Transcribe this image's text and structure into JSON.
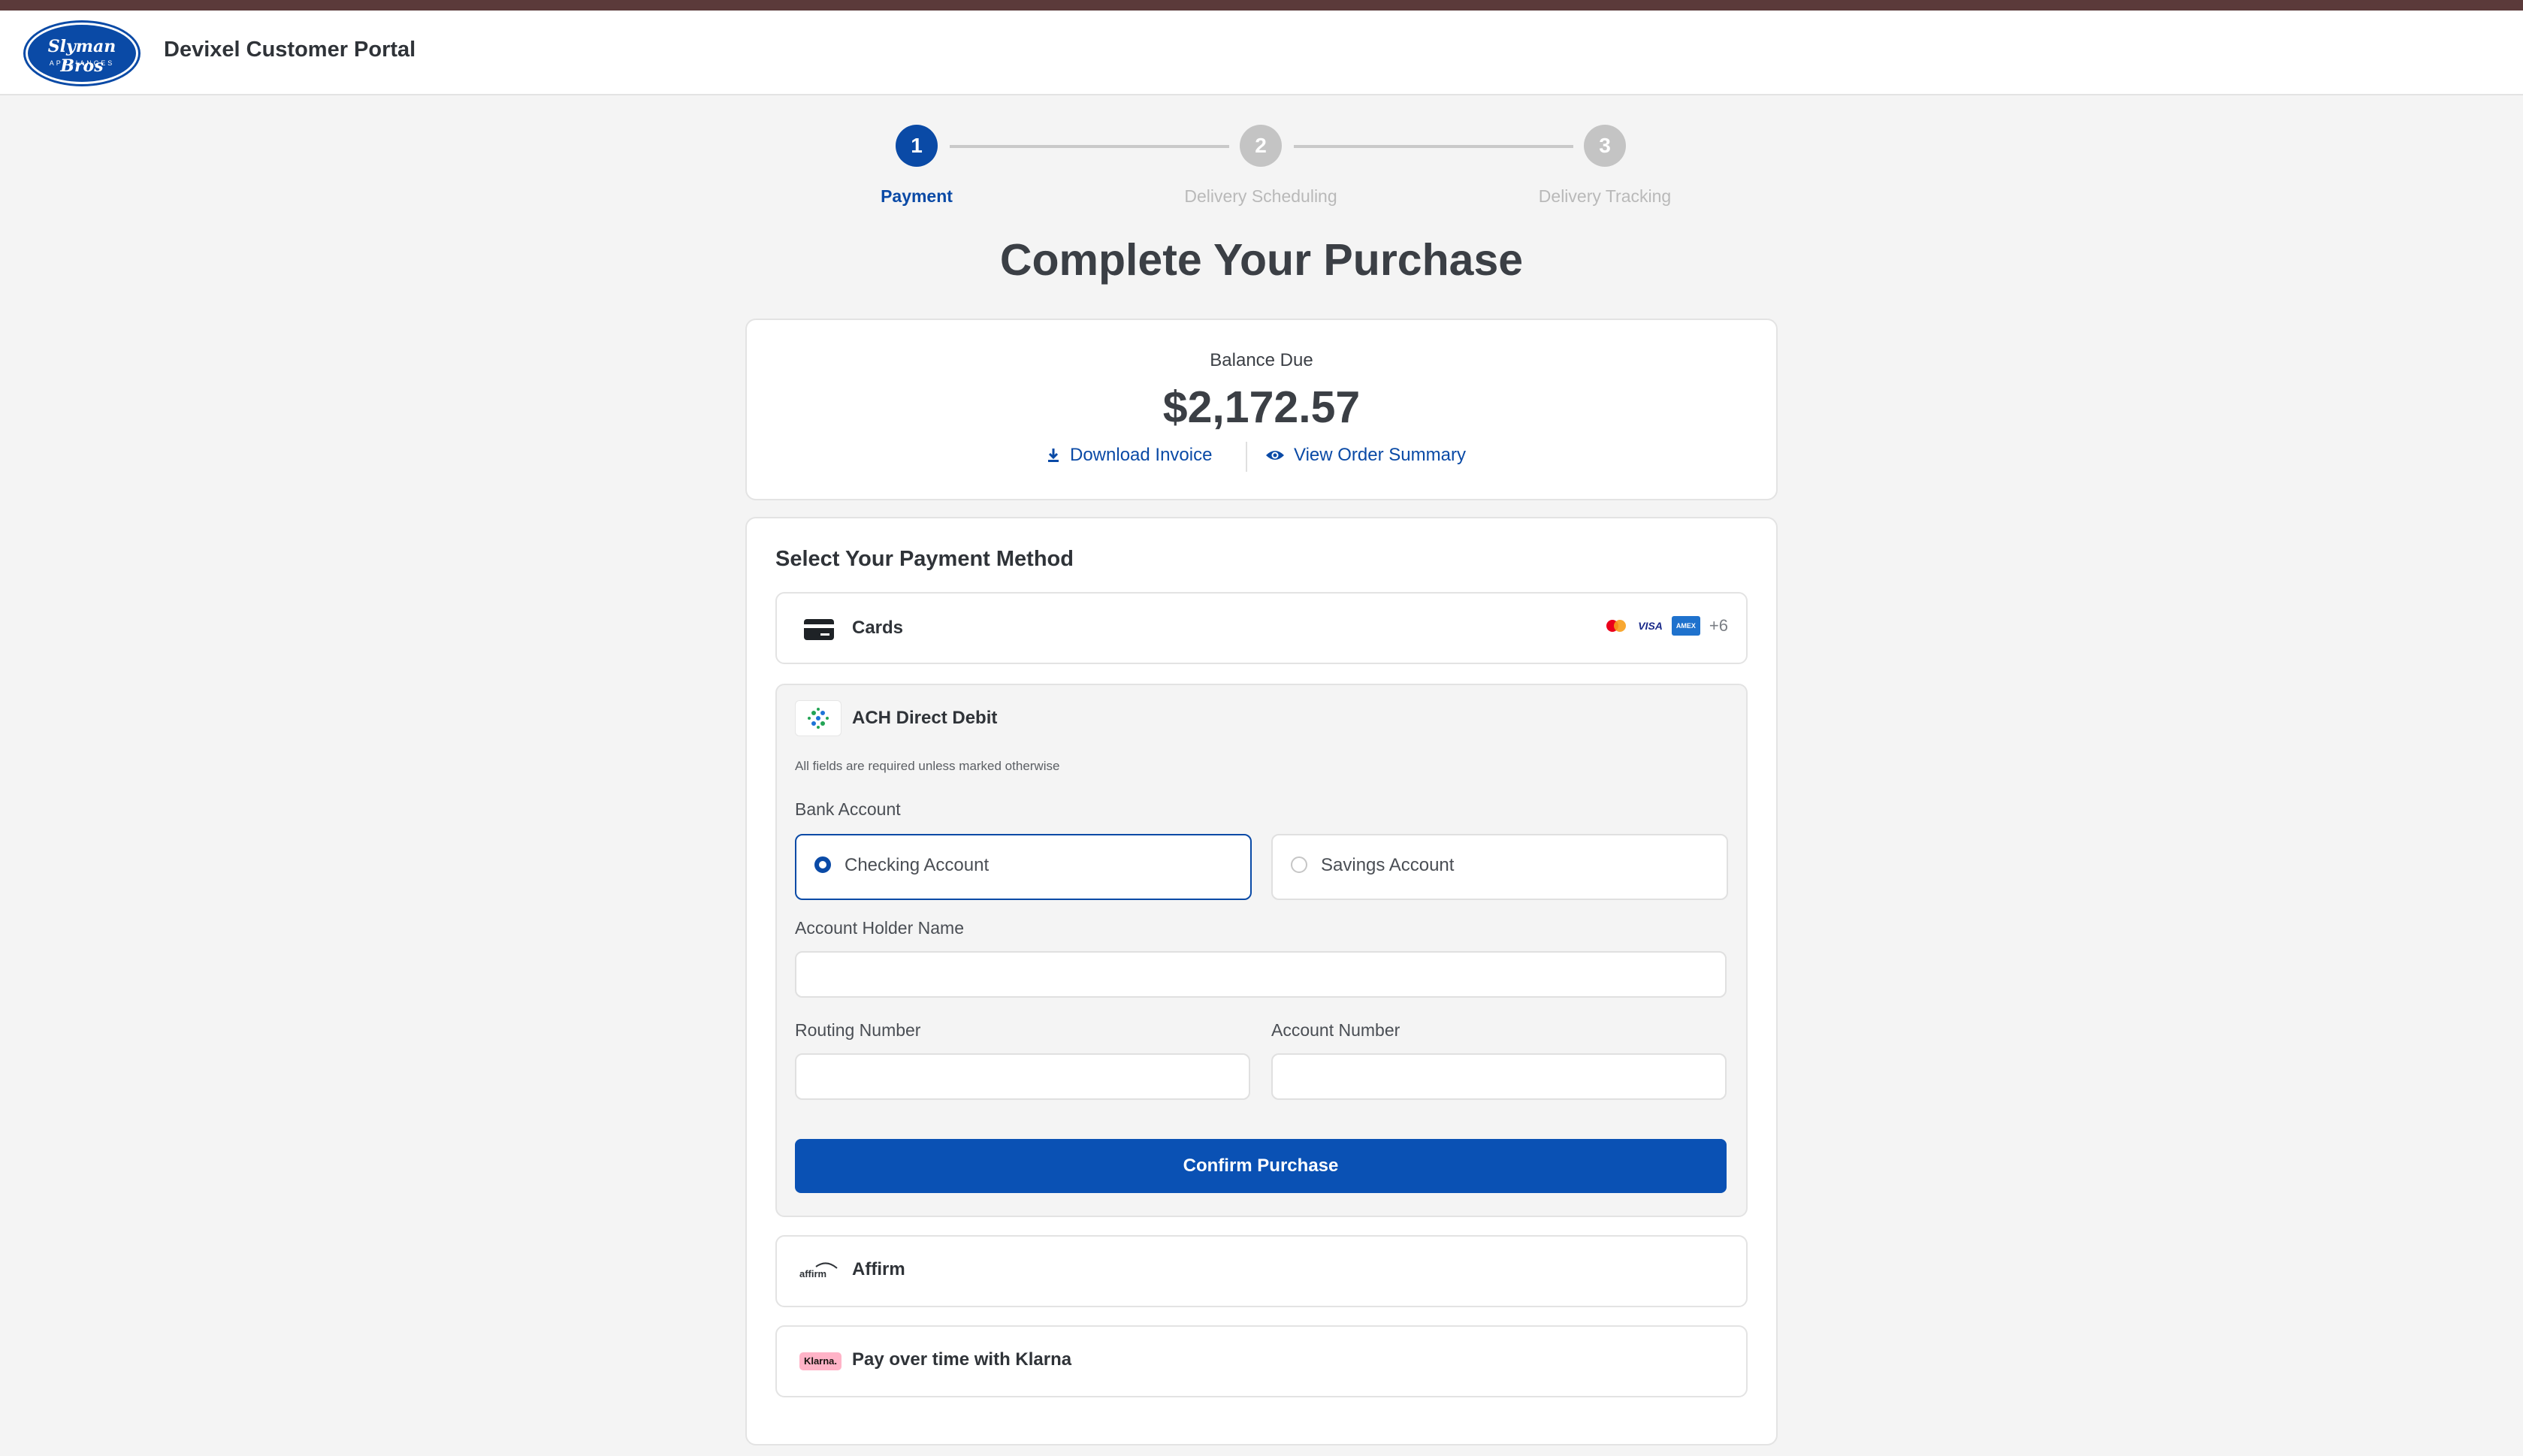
{
  "header": {
    "logo_script": "Slyman Bros",
    "logo_sub": "APPLIANCES",
    "portal_title": "Devixel Customer Portal"
  },
  "stepper": {
    "steps": [
      {
        "number": "1",
        "label": "Payment",
        "state": "active"
      },
      {
        "number": "2",
        "label": "Delivery Scheduling",
        "state": "upcoming"
      },
      {
        "number": "3",
        "label": "Delivery Tracking",
        "state": "upcoming"
      }
    ]
  },
  "page_title": "Complete Your Purchase",
  "balance": {
    "label": "Balance Due",
    "amount": "$2,172.57",
    "download_invoice": "Download Invoice",
    "view_order_summary": "View Order Summary"
  },
  "payment": {
    "heading": "Select Your Payment Method",
    "cards": {
      "label": "Cards",
      "brands": [
        "mastercard",
        "visa",
        "amex"
      ],
      "visa_text": "VISA",
      "amex_text": "AMEX",
      "more": "+6"
    },
    "ach": {
      "label": "ACH Direct Debit",
      "note": "All fields are required unless marked otherwise",
      "bank_account_label": "Bank Account",
      "checking_label": "Checking Account",
      "savings_label": "Savings Account",
      "selected": "Checking Account",
      "holder_label": "Account Holder Name",
      "holder_value": "",
      "routing_label": "Routing Number",
      "routing_value": "",
      "account_label": "Account Number",
      "account_value": "",
      "confirm": "Confirm Purchase"
    },
    "affirm": {
      "label": "Affirm",
      "logo_text": "affirm"
    },
    "klarna": {
      "label": "Pay over time with Klarna",
      "logo_text": "Klarna."
    }
  },
  "colors": {
    "brand_blue": "#0a4aa6",
    "button_blue": "#0a51b4",
    "top_stripe": "#5b3a3a",
    "inactive_step": "#c4c4c4",
    "klarna_pink": "#ffb3c7"
  }
}
